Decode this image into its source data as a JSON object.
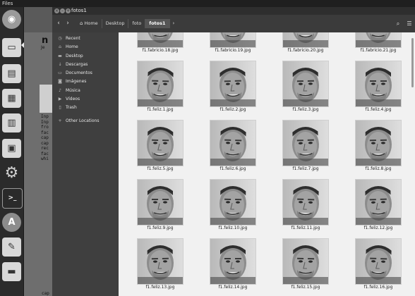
{
  "topbar": {
    "title": "Files"
  },
  "launcher": [
    {
      "name": "ubuntu-dash-icon",
      "glyph": "◉"
    },
    {
      "name": "files-app-icon",
      "glyph": "▭"
    },
    {
      "name": "document-viewer-icon",
      "glyph": "▤"
    },
    {
      "name": "spreadsheet-icon",
      "glyph": "▦"
    },
    {
      "name": "presentation-icon",
      "glyph": "▥"
    },
    {
      "name": "software-center-icon",
      "glyph": "▣"
    },
    {
      "name": "settings-gear-icon",
      "glyph": "⚙"
    },
    {
      "name": "terminal-icon",
      "glyph": ">_"
    },
    {
      "name": "updater-icon",
      "glyph": "A"
    },
    {
      "name": "text-editor-icon",
      "glyph": "✎"
    },
    {
      "name": "drive-icon",
      "glyph": "▬"
    }
  ],
  "background_terminal": {
    "title_fragment": "n",
    "subtitle_fragment": "Je",
    "lines": [
      "Inp",
      "Inp",
      "fro",
      "fac",
      "cap",
      "cap",
      "rec",
      "fac",
      "whi"
    ],
    "bottom_lines": [
      "cap",
      "cap"
    ]
  },
  "window": {
    "title": "fotos1",
    "breadcrumbs": [
      "Home",
      "Desktop",
      "foto",
      "fotos1"
    ],
    "current_crumb": "fotos1"
  },
  "sidebar": {
    "items": [
      {
        "label": "Recent",
        "icon": "clock-icon",
        "glyph": "◷"
      },
      {
        "label": "Home",
        "icon": "home-icon",
        "glyph": "⌂"
      },
      {
        "label": "Desktop",
        "icon": "folder-icon",
        "glyph": "▬"
      },
      {
        "label": "Descargas",
        "icon": "download-icon",
        "glyph": "↓"
      },
      {
        "label": "Documentos",
        "icon": "document-icon",
        "glyph": "▭"
      },
      {
        "label": "Imágenes",
        "icon": "camera-icon",
        "glyph": "◙"
      },
      {
        "label": "Música",
        "icon": "music-icon",
        "glyph": "♪"
      },
      {
        "label": "Vídeos",
        "icon": "video-icon",
        "glyph": "▶"
      },
      {
        "label": "Trash",
        "icon": "trash-icon",
        "glyph": "▯"
      }
    ],
    "other_locations": {
      "label": "Other Locations",
      "icon": "plus-icon",
      "glyph": "+"
    }
  },
  "files": [
    "f1.fabricio.18.jpg",
    "f1.fabricio.19.jpg",
    "f1.fabricio.20.jpg",
    "f1.fabricio.21.jpg",
    "f1.feliz.1.jpg",
    "f1.feliz.2.jpg",
    "f1.feliz.3.jpg",
    "f1.feliz.4.jpg",
    "f1.feliz.5.jpg",
    "f1.feliz.6.jpg",
    "f1.feliz.7.jpg",
    "f1.feliz.8.jpg",
    "f1.feliz.9.jpg",
    "f1.feliz.10.jpg",
    "f1.feliz.11.jpg",
    "f1.feliz.12.jpg",
    "f1.feliz.13.jpg",
    "f1.feliz.14.jpg",
    "f1.feliz.15.jpg",
    "f1.feliz.16.jpg"
  ]
}
